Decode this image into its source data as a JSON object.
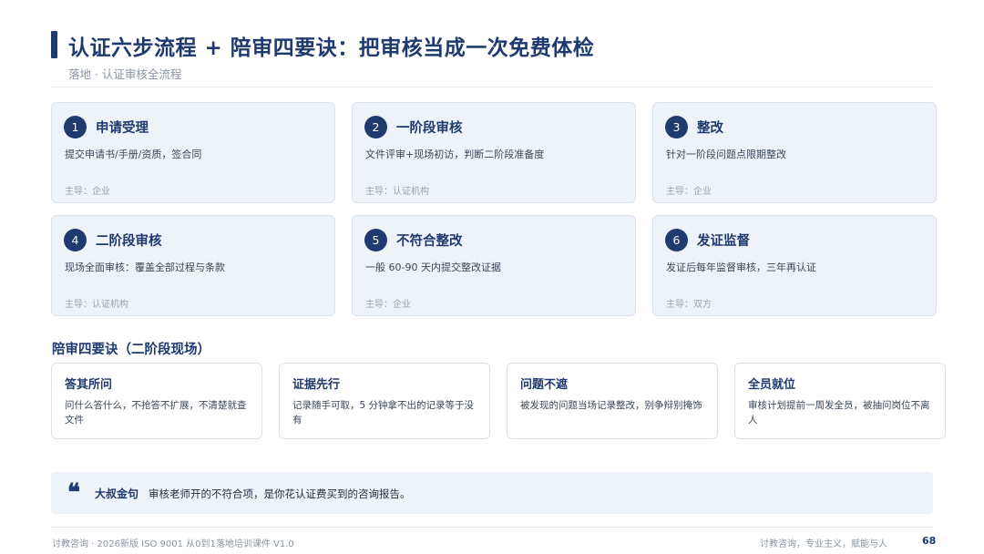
{
  "header": {
    "title": "认证六步流程 + 陪审四要诀：把审核当成一次免费体检",
    "subtitle": "落地 · 认证审核全流程"
  },
  "steps": [
    {
      "num": "1",
      "title": "申请受理",
      "desc": "提交申请书/手册/资质，签合同",
      "owner": "主导：企业"
    },
    {
      "num": "2",
      "title": "一阶段审核",
      "desc": "文件评审+现场初访，判断二阶段准备度",
      "owner": "主导：认证机构"
    },
    {
      "num": "3",
      "title": "整改",
      "desc": "针对一阶段问题点限期整改",
      "owner": "主导：企业"
    },
    {
      "num": "4",
      "title": "二阶段审核",
      "desc": "现场全面审核：覆盖全部过程与条款",
      "owner": "主导：认证机构"
    },
    {
      "num": "5",
      "title": "不符合整改",
      "desc": "一般 60-90 天内提交整改证据",
      "owner": "主导：企业"
    },
    {
      "num": "6",
      "title": "发证监督",
      "desc": "发证后每年监督审核，三年再认证",
      "owner": "主导：双方"
    }
  ],
  "tips_section": {
    "title": "陪审四要诀（二阶段现场）",
    "items": [
      {
        "title": "答其所问",
        "desc": "问什么答什么，不抢答不扩展，不清楚就查文件"
      },
      {
        "title": "证据先行",
        "desc": "记录随手可取，5 分钟拿不出的记录等于没有"
      },
      {
        "title": "问题不遮",
        "desc": "被发现的问题当场记录整改，别争辩别掩饰"
      },
      {
        "title": "全员就位",
        "desc": "审核计划提前一周发全员，被抽问岗位不离人"
      }
    ]
  },
  "quote": {
    "mark": "❝",
    "label": "大叔金句",
    "text": "审核老师开的不符合项，是你花认证费买到的咨询报告。"
  },
  "footer": {
    "left": "讨教咨询 · 2026新版 ISO 9001 从0到1落地培训课件 V1.0",
    "right": "讨教咨询，专业主义，赋能与人",
    "page": "68"
  },
  "colors": {
    "primary": "#1e3a6e",
    "card_bg": "#eef3f9",
    "muted": "#8a94a3"
  }
}
